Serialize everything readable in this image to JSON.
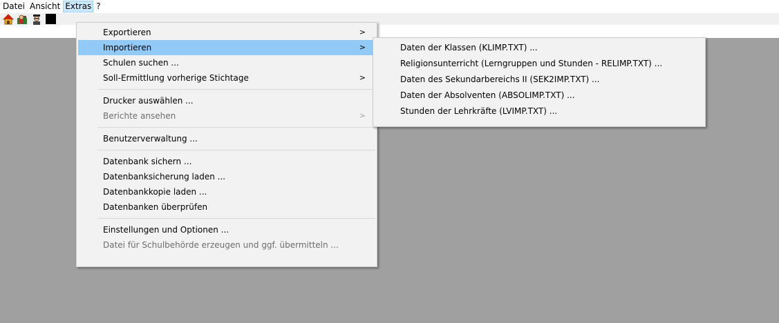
{
  "menubar": {
    "items": [
      "Datei",
      "Ansicht",
      "Extras",
      "?"
    ]
  },
  "toolbar": {
    "buttons": [
      {
        "icon": "home-icon"
      },
      {
        "icon": "person-icon"
      },
      {
        "icon": "teacher-icon"
      },
      {
        "icon": "black-square-icon"
      }
    ]
  },
  "extras_menu": {
    "items": [
      {
        "label": "Exportieren",
        "submenu": true
      },
      {
        "label": "Importieren",
        "submenu": true,
        "highlighted": true
      },
      {
        "label": "Schulen suchen ..."
      },
      {
        "label": "Soll-Ermittlung vorherige Stichtage",
        "submenu": true
      },
      {
        "label": "Drucker auswählen ..."
      },
      {
        "label": "Berichte ansehen",
        "submenu": true,
        "disabled": true
      },
      {
        "label": "Benutzerverwaltung ..."
      },
      {
        "label": "Datenbank sichern ..."
      },
      {
        "label": "Datenbanksicherung laden ..."
      },
      {
        "label": "Datenbankkopie laden ..."
      },
      {
        "label": "Datenbanken überprüfen"
      },
      {
        "label": "Einstellungen und Optionen ..."
      },
      {
        "label": "Datei für Schulbehörde erzeugen und ggf. übermitteln ...",
        "disabled": true
      }
    ],
    "submenu_arrow": ">"
  },
  "import_submenu": {
    "items": [
      {
        "label": "Daten der Klassen (KLIMP.TXT) ..."
      },
      {
        "label": "Religionsunterricht (Lerngruppen und Stunden - RELIMP.TXT) ..."
      },
      {
        "label": "Daten des Sekundarbereichs II (SEK2IMP.TXT) ..."
      },
      {
        "label": "Daten der Absolventen (ABSOLIMP.TXT) ..."
      },
      {
        "label": "Stunden der Lehrkräfte (LVIMP.TXT) ..."
      }
    ]
  },
  "colors": {
    "workspace": "#a0a0a0",
    "menu_bg": "#f2f2f2",
    "highlight": "#91c9f7",
    "active_menubar": "#cce8ff"
  }
}
